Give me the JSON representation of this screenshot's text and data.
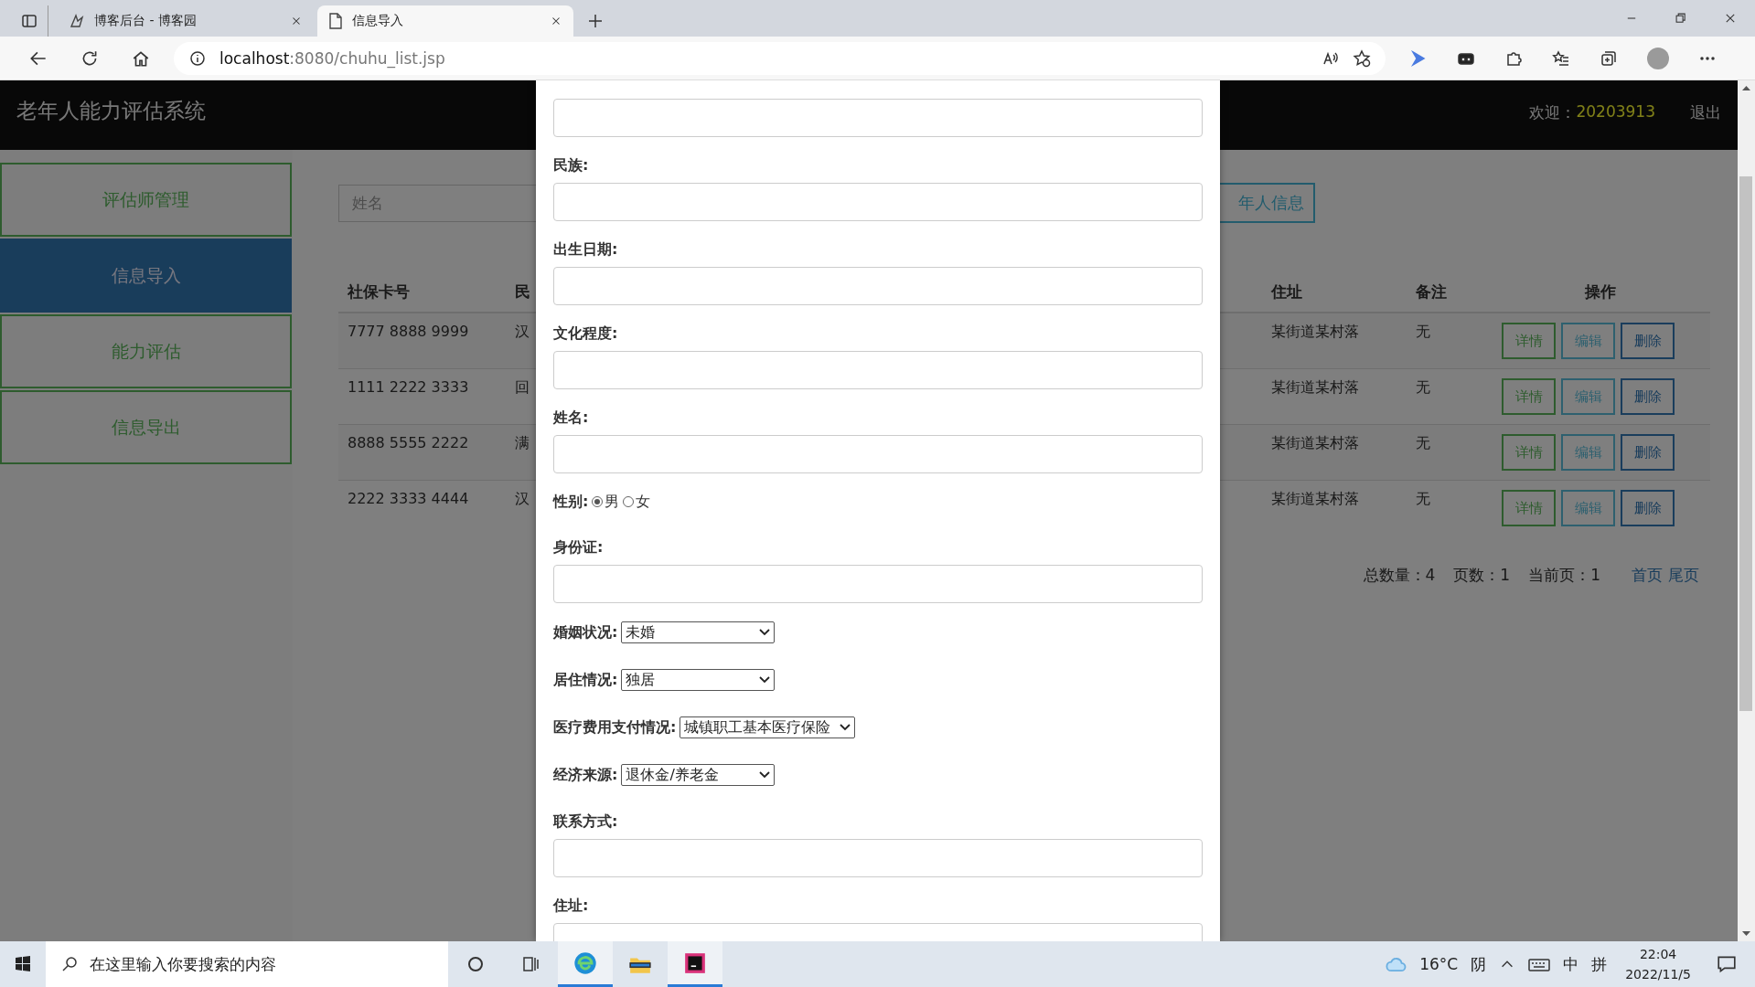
{
  "browser": {
    "tabs": [
      {
        "title": "博客后台 - 博客园",
        "selected": false
      },
      {
        "title": "信息导入",
        "selected": true
      }
    ],
    "url_host": "localhost",
    "url_path": ":8080/chuhu_list.jsp"
  },
  "header": {
    "title": "老年人能力评估系统",
    "welcome_label": "欢迎：",
    "username": "20203913",
    "logout": "退出"
  },
  "sidebar": {
    "items": [
      {
        "label": "评估师管理",
        "selected": false
      },
      {
        "label": "信息导入",
        "selected": true
      },
      {
        "label": "能力评估",
        "selected": false
      },
      {
        "label": "信息导出",
        "selected": false
      }
    ]
  },
  "toolbar": {
    "search_placeholder": "姓名",
    "add_button": "年人信息"
  },
  "table": {
    "columns": [
      "社保卡号",
      "民",
      "住址",
      "备注",
      "操作"
    ],
    "rows": [
      {
        "card_no": "7777 8888 9999",
        "ethnicity": "汉",
        "address": "某街道某村落",
        "remark": "无",
        "actions": [
          {
            "label": "详情",
            "color": "#2e5c2e"
          },
          {
            "label": "编辑",
            "color": "#2e606f"
          },
          {
            "label": "删除",
            "color": "#1a3d5c"
          }
        ]
      },
      {
        "card_no": "1111 2222 3333",
        "ethnicity": "回",
        "address": "某街道某村落",
        "remark": "无",
        "actions": [
          {
            "label": "详情",
            "color": "#2e5c2e"
          },
          {
            "label": "编辑",
            "color": "#2e606f"
          },
          {
            "label": "删除",
            "color": "#1a3d5c"
          }
        ]
      },
      {
        "card_no": "8888 5555 2222",
        "ethnicity": "满",
        "address": "某街道某村落",
        "remark": "无",
        "actions": [
          {
            "label": "详情",
            "color": "#2e5c2e"
          },
          {
            "label": "编辑",
            "color": "#2e606f"
          },
          {
            "label": "删除",
            "color": "#1a3d5c"
          }
        ]
      },
      {
        "card_no": "2222 3333 4444",
        "ethnicity": "汉",
        "address": "某街道某村落",
        "remark": "无",
        "actions": [
          {
            "label": "详情",
            "color": "#2e5c2e"
          },
          {
            "label": "编辑",
            "color": "#2e606f"
          },
          {
            "label": "删除",
            "color": "#1a3d5c"
          }
        ]
      }
    ]
  },
  "pagination": {
    "total": "总数量：4",
    "pages": "页数：1",
    "current": "当前页：1",
    "links": [
      "首页",
      "尾页"
    ]
  },
  "modal": {
    "fields": [
      {
        "kind": "text",
        "label": "民族:"
      },
      {
        "kind": "text",
        "label": "出生日期:"
      },
      {
        "kind": "text",
        "label": "文化程度:"
      },
      {
        "kind": "text",
        "label": "姓名:"
      },
      {
        "kind": "radio",
        "label": "性别:",
        "options": [
          {
            "label": "男",
            "selected": true
          },
          {
            "label": "女",
            "selected": false
          }
        ]
      },
      {
        "kind": "text",
        "label": "身份证:"
      },
      {
        "kind": "select",
        "label": "婚姻状况:",
        "value": "未婚"
      },
      {
        "kind": "select",
        "label": "居住情况:",
        "value": "独居"
      },
      {
        "kind": "select",
        "label": "医疗费用支付情况:",
        "value": "城镇职工基本医疗保险"
      },
      {
        "kind": "select",
        "label": "经济来源:",
        "value": "退休金/养老金"
      },
      {
        "kind": "text",
        "label": "联系方式:"
      },
      {
        "kind": "text",
        "label": "住址:"
      }
    ]
  },
  "taskbar": {
    "search_placeholder": "在这里输入你要搜索的内容",
    "weather": "16°C",
    "condition": "阴",
    "ime_mode": "中",
    "ime": "拼",
    "time": "22:04",
    "date": "2022/11/5"
  }
}
